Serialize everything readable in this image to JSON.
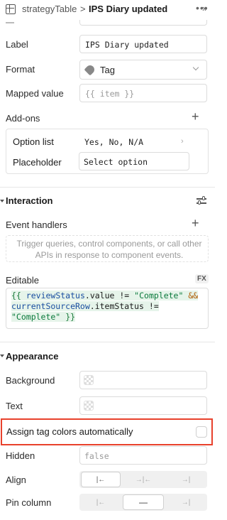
{
  "header": {
    "title_parent": "strategyTable",
    "title_sep": ">",
    "title_current": "IPS Diary updated",
    "more_icon": "ellipsis",
    "collapse_icon": "double-chevron-right"
  },
  "columns": {
    "label_label": "Label",
    "label_value": "IPS Diary updated",
    "format_label": "Format",
    "format_value": "Tag",
    "mapped_label": "Mapped value",
    "mapped_placeholder": "{{ item }}",
    "addons_label": "Add-ons",
    "option_list_label": "Option list",
    "option_list_value": "Yes, No, N/A",
    "placeholder_label": "Placeholder",
    "placeholder_value": "Select option"
  },
  "interaction": {
    "title": "Interaction",
    "event_handlers_label": "Event handlers",
    "event_handlers_hint": "Trigger queries, control components, or call other APIs in response to component events.",
    "editable_label": "Editable",
    "fx_label": "FX",
    "code": {
      "open": "{{",
      "var1": "reviewStatus",
      "prop1": ".value",
      "op1": "!=",
      "str1": "\"Complete\"",
      "and": "&&",
      "var2": "currentSourceRow",
      "prop2": ".itemStatus",
      "op2": "!=",
      "str2": "\"Complete\"",
      "close": "}}"
    }
  },
  "appearance": {
    "title": "Appearance",
    "background_label": "Background",
    "text_label": "Text",
    "assign_colors_label": "Assign tag colors automatically",
    "assign_colors_checked": false,
    "hidden_label": "Hidden",
    "hidden_value": "false",
    "align_label": "Align",
    "align_options": [
      "|←",
      "→|←",
      "→|"
    ],
    "align_selected": 0,
    "pin_label": "Pin column",
    "pin_options": [
      "|←",
      "—",
      "→|"
    ],
    "pin_selected": 1
  },
  "colors": {
    "highlight_border": "#e8412c",
    "code_bg": "#eef8f0"
  }
}
